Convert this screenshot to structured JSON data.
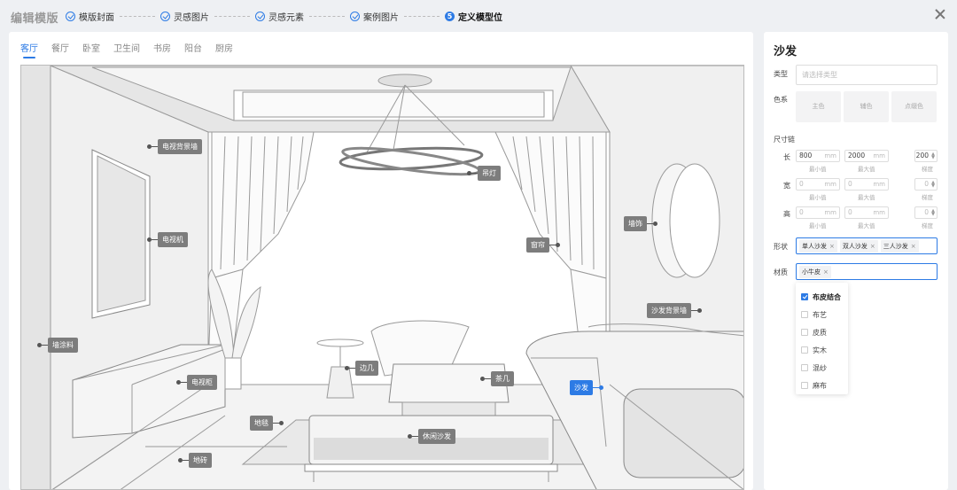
{
  "header": {
    "title": "编辑模版",
    "steps": [
      {
        "label": "模版封面",
        "state": "done"
      },
      {
        "label": "灵感图片",
        "state": "done"
      },
      {
        "label": "灵感元素",
        "state": "done"
      },
      {
        "label": "案例图片",
        "state": "done"
      },
      {
        "label": "定义模型位",
        "state": "active",
        "number": "5"
      }
    ]
  },
  "room_tabs": [
    "客厅",
    "餐厅",
    "卧室",
    "卫生间",
    "书房",
    "阳台",
    "厨房"
  ],
  "active_room": "客厅",
  "scene_tags": {
    "tv_wall": "电视背景墙",
    "tv": "电视机",
    "chandelier": "吊灯",
    "wall_deco": "墙饰",
    "curtain": "窗帘",
    "sofa_wall": "沙发背景墙",
    "wall_paint": "墙涂料",
    "side_table": "边几",
    "coffee_table": "茶几",
    "tv_cabinet": "电视柜",
    "sofa": "沙发",
    "rug": "地毯",
    "lounge_sofa": "休闲沙发",
    "floor_tile": "地砖"
  },
  "panel": {
    "title": "沙发",
    "type_label": "类型",
    "type_placeholder": "请选择类型",
    "color_label": "色系",
    "colors": [
      "主色",
      "辅色",
      "点缀色"
    ],
    "size_label": "尺寸链",
    "length_label": "长",
    "width_label": "宽",
    "height_label": "高",
    "unit": "mm",
    "min_label": "最小值",
    "max_label": "最大值",
    "step_label": "梯度",
    "length_min": "800",
    "length_max": "2000",
    "length_step": "200",
    "width_min": "0",
    "width_max": "0",
    "width_step": "0",
    "height_min": "0",
    "height_max": "0",
    "height_step": "0",
    "shape_label": "形状",
    "shapes": [
      "单人沙发",
      "双人沙发",
      "三人沙发"
    ],
    "material_label": "材质",
    "materials_selected": [
      "小牛皮"
    ],
    "material_options": [
      {
        "label": "布皮结合",
        "checked": true
      },
      {
        "label": "布艺",
        "checked": false
      },
      {
        "label": "皮质",
        "checked": false
      },
      {
        "label": "实木",
        "checked": false
      },
      {
        "label": "混纱",
        "checked": false
      },
      {
        "label": "麻布",
        "checked": false
      }
    ]
  }
}
